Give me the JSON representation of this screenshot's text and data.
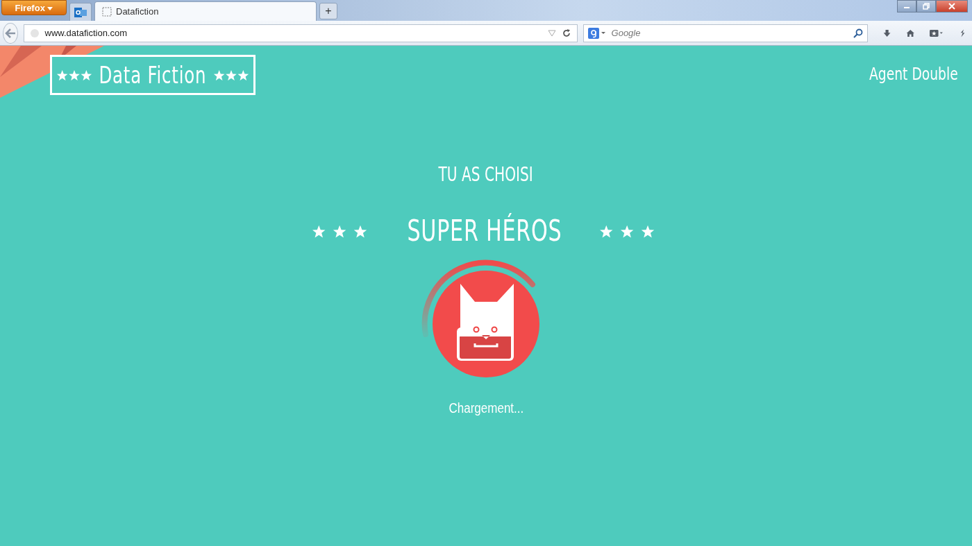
{
  "browser": {
    "menu_button": "Firefox",
    "tabs": [
      {
        "label": "Datafiction",
        "selected": true
      }
    ],
    "new_tab": "+",
    "address": "www.datafiction.com",
    "search_placeholder": "Google"
  },
  "page": {
    "logo": "Data Fiction",
    "agent": "Agent Double",
    "intro": "TU AS CHOISI",
    "choice": "SUPER HÉROS",
    "loading": "Chargement..."
  }
}
